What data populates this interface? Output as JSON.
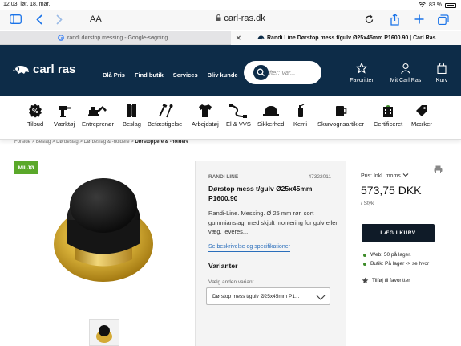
{
  "status_bar": {
    "time": "12.03",
    "date": "lør. 18. mar.",
    "battery": "83 %"
  },
  "browser": {
    "aa_label": "AA",
    "url": "carl-ras.dk",
    "tabs": [
      {
        "title": "randi dørstop messing - Google-søgning",
        "active": false
      },
      {
        "title": "Randi Line Dørstop mess t/gulv Ø25x45mm P1600.90 | Carl Ras",
        "active": true
      }
    ]
  },
  "header": {
    "logo": "carl ras",
    "nav": [
      "Blå Pris",
      "Find butik",
      "Services",
      "Bliv kunde"
    ],
    "search_placeholder": "Søg efter: Var...",
    "icons": [
      {
        "label": "Favoritter",
        "icon": "star-icon"
      },
      {
        "label": "Mit Carl Ras",
        "icon": "user-icon"
      },
      {
        "label": "Kurv",
        "icon": "bag-icon"
      }
    ]
  },
  "categories": [
    {
      "label": "Tilbud",
      "icon": "percent-icon"
    },
    {
      "label": "Værktøj",
      "icon": "drill-icon"
    },
    {
      "label": "Entreprenør",
      "icon": "excavator-icon"
    },
    {
      "label": "Beslag",
      "icon": "hinge-icon"
    },
    {
      "label": "Befæstigelse",
      "icon": "screw-icon"
    },
    {
      "label": "Arbejdstøj",
      "icon": "shirt-icon"
    },
    {
      "label": "El & VVS",
      "icon": "cable-icon"
    },
    {
      "label": "Sikkerhed",
      "icon": "helmet-icon"
    },
    {
      "label": "Kemi",
      "icon": "spray-icon"
    },
    {
      "label": "Skurvognsartikler",
      "icon": "mug-icon"
    },
    {
      "label": "Certificeret",
      "icon": "building-icon"
    },
    {
      "label": "Mærker",
      "icon": "tag-icon"
    }
  ],
  "breadcrumb": [
    "Forside",
    "Beslag",
    "Dørbeslag",
    "Dørbeslag & -holdere",
    "Dørstoppere & -holdere"
  ],
  "product": {
    "badge": "MILJØ",
    "brand": "RANDI LINE",
    "sku": "47322011",
    "title": "Dørstop mess t/gulv Ø25x45mm P1600.90",
    "description": "Randi-Line. Messing. Ø 25 mm rør, sort gummianslag, med skjult montering for gulv eller væg, leveres...",
    "specs_link": "Se beskrivelse og specifikationer",
    "variants_heading": "Varianter",
    "variant_label": "Vælg anden variant",
    "variant_selected": "Dørstop mess t/gulv Ø25x45mm P1..."
  },
  "pricing": {
    "price_label": "Pris: Inkl. moms",
    "price": "573,75 DKK",
    "unit": "/ Styk",
    "cart_button": "LÆG I KURV",
    "web_stock": "Web: 50 på lager.",
    "store_stock": "Butik: På lager -> se hvor",
    "favorite": "Tilføj til favoritter"
  },
  "colors": {
    "header_bg": "#0d2c48",
    "cart_btn": "#0f1b28",
    "badge": "#5aa82a",
    "link": "#2a6ebb"
  }
}
